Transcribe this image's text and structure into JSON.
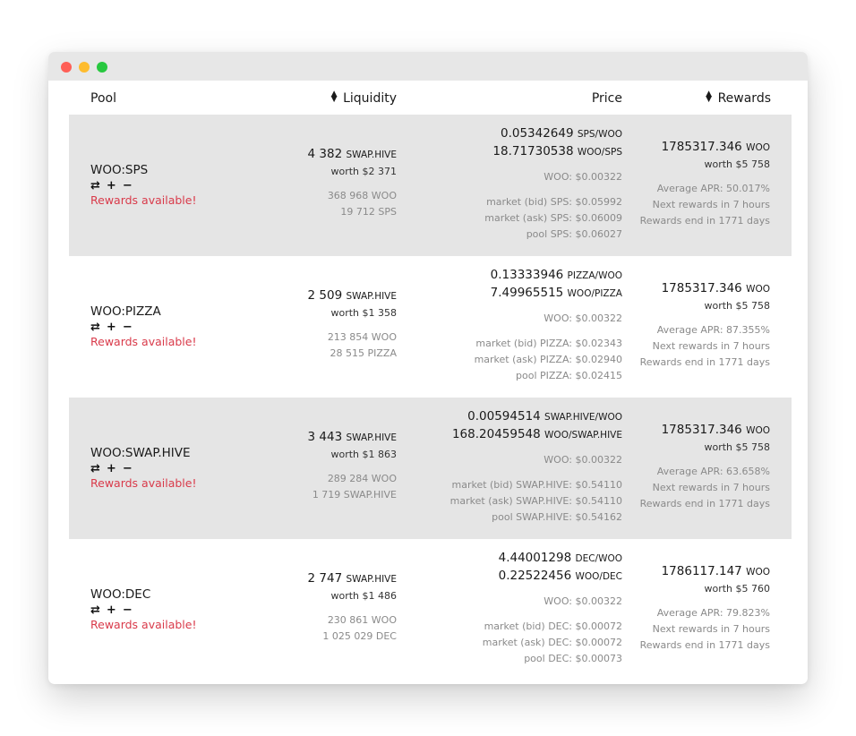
{
  "header": {
    "pool": "Pool",
    "liquidity": "Liquidity",
    "price": "Price",
    "rewards": "Rewards"
  },
  "actions": {
    "swap": "⇄",
    "add": "+",
    "remove": "−"
  },
  "rows": [
    {
      "pool": "WOO:SPS",
      "rewards_available": "Rewards available!",
      "liquidity_amount": "4 382",
      "liquidity_unit": "SWAP.HIVE",
      "liquidity_worth": "worth $2 371",
      "reserve_1": "368 968 WOO",
      "reserve_2": "19 712 SPS",
      "price_1_value": "0.05342649",
      "price_1_unit": "SPS/WOO",
      "price_2_value": "18.71730538",
      "price_2_unit": "WOO/SPS",
      "woo_price": "WOO: $0.00322",
      "market_bid": "market (bid) SPS: $0.05992",
      "market_ask": "market (ask) SPS: $0.06009",
      "pool_price": "pool SPS: $0.06027",
      "reward_amount": "1785317.346",
      "reward_unit": "WOO",
      "reward_worth": "worth $5 758",
      "apr": "Average APR: 50.017%",
      "next_rewards": "Next rewards in 7 hours",
      "rewards_end": "Rewards end in 1771 days"
    },
    {
      "pool": "WOO:PIZZA",
      "rewards_available": "Rewards available!",
      "liquidity_amount": "2 509",
      "liquidity_unit": "SWAP.HIVE",
      "liquidity_worth": "worth $1 358",
      "reserve_1": "213 854 WOO",
      "reserve_2": "28 515 PIZZA",
      "price_1_value": "0.13333946",
      "price_1_unit": "PIZZA/WOO",
      "price_2_value": "7.49965515",
      "price_2_unit": "WOO/PIZZA",
      "woo_price": "WOO: $0.00322",
      "market_bid": "market (bid) PIZZA: $0.02343",
      "market_ask": "market (ask) PIZZA: $0.02940",
      "pool_price": "pool PIZZA: $0.02415",
      "reward_amount": "1785317.346",
      "reward_unit": "WOO",
      "reward_worth": "worth $5 758",
      "apr": "Average APR: 87.355%",
      "next_rewards": "Next rewards in 7 hours",
      "rewards_end": "Rewards end in 1771 days"
    },
    {
      "pool": "WOO:SWAP.HIVE",
      "rewards_available": "Rewards available!",
      "liquidity_amount": "3 443",
      "liquidity_unit": "SWAP.HIVE",
      "liquidity_worth": "worth $1 863",
      "reserve_1": "289 284 WOO",
      "reserve_2": "1 719 SWAP.HIVE",
      "price_1_value": "0.00594514",
      "price_1_unit": "SWAP.HIVE/WOO",
      "price_2_value": "168.20459548",
      "price_2_unit": "WOO/SWAP.HIVE",
      "woo_price": "WOO: $0.00322",
      "market_bid": "market (bid) SWAP.HIVE: $0.54110",
      "market_ask": "market (ask) SWAP.HIVE: $0.54110",
      "pool_price": "pool SWAP.HIVE: $0.54162",
      "reward_amount": "1785317.346",
      "reward_unit": "WOO",
      "reward_worth": "worth $5 758",
      "apr": "Average APR: 63.658%",
      "next_rewards": "Next rewards in 7 hours",
      "rewards_end": "Rewards end in 1771 days"
    },
    {
      "pool": "WOO:DEC",
      "rewards_available": "Rewards available!",
      "liquidity_amount": "2 747",
      "liquidity_unit": "SWAP.HIVE",
      "liquidity_worth": "worth $1 486",
      "reserve_1": "230 861 WOO",
      "reserve_2": "1 025 029 DEC",
      "price_1_value": "4.44001298",
      "price_1_unit": "DEC/WOO",
      "price_2_value": "0.22522456",
      "price_2_unit": "WOO/DEC",
      "woo_price": "WOO: $0.00322",
      "market_bid": "market (bid) DEC: $0.00072",
      "market_ask": "market (ask) DEC: $0.00072",
      "pool_price": "pool DEC: $0.00073",
      "reward_amount": "1786117.147",
      "reward_unit": "WOO",
      "reward_worth": "worth $5 760",
      "apr": "Average APR: 79.823%",
      "next_rewards": "Next rewards in 7 hours",
      "rewards_end": "Rewards end in 1771 days"
    }
  ]
}
